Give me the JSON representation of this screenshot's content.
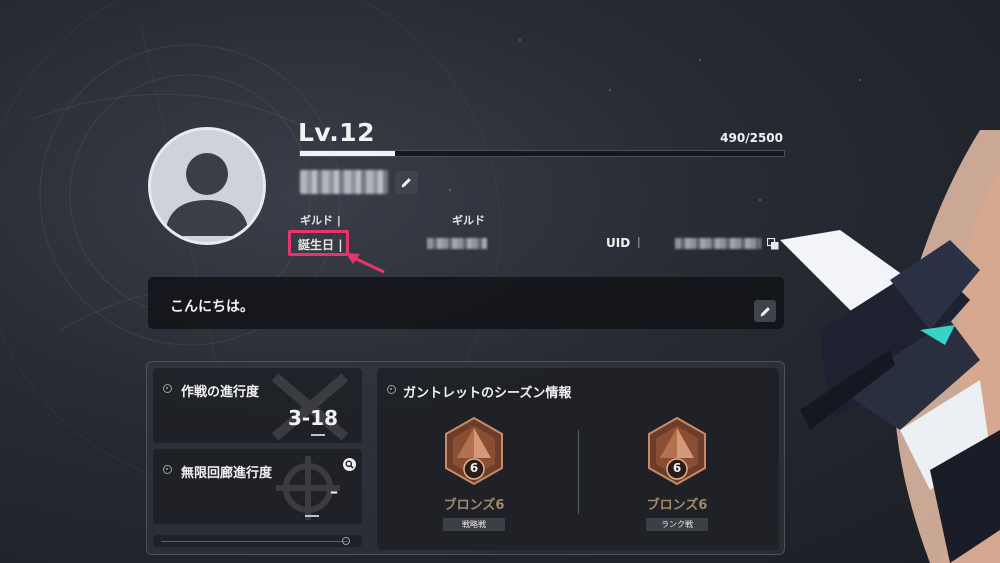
{
  "profile": {
    "level": "Lv.12",
    "exp_text": "490/2500",
    "exp_fraction": 0.196,
    "guild_label_left": "ギルド",
    "guild_label_mid": "ギルド",
    "birthday_label": "誕生日",
    "uid_label": "UID",
    "separator": "|"
  },
  "greeting": {
    "text": "こんにちは。"
  },
  "progress": {
    "operation_title": "作戦の進行度",
    "operation_value": "3-18",
    "corridor_title": "無限回廊進行度",
    "corridor_value": "–"
  },
  "gauntlet": {
    "title": "ガントレットのシーズン情報",
    "ranks": [
      {
        "name": "ブロンズ6",
        "badge": "6",
        "tag": "戦略戦"
      },
      {
        "name": "ブロンズ6",
        "badge": "6",
        "tag": "ランク戦"
      }
    ]
  },
  "colors": {
    "highlight": "#e8336d",
    "bronze": "#a08a6a"
  },
  "icons": [
    "avatar-icon",
    "pencil-icon",
    "copy-icon",
    "search-icon",
    "arrow-icon"
  ]
}
